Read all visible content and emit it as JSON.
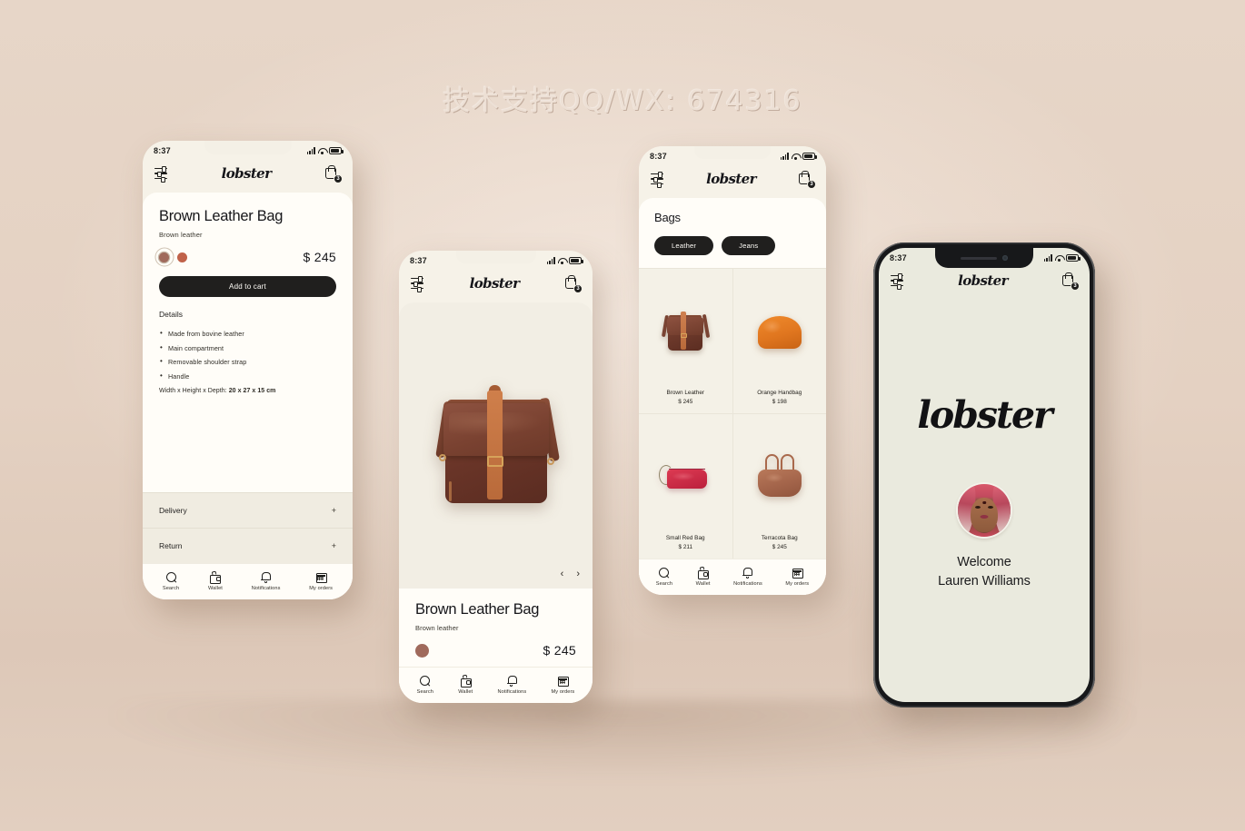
{
  "watermark": "技术支持QQ/WX: 674316",
  "theme": {
    "background": "#e3d0c1",
    "screen_bg": "#f6f2e8",
    "sheet_bg": "#fffdf8",
    "ink": "#1d1d1b",
    "accent_dark": "#201f1e",
    "swatch_selected": "#a06a5c",
    "swatch_second": "#c0624a"
  },
  "brand": {
    "name": "lobster"
  },
  "status_bar": {
    "time": "8:37",
    "signal_icon": "cellular-signal-icon",
    "wifi_icon": "wifi-icon",
    "battery_icon": "battery-icon"
  },
  "app_header": {
    "filter_icon": "filter-sliders-icon",
    "logo": "lobster",
    "cart_icon": "shopping-bag-icon",
    "cart_badge": "3"
  },
  "bottom_nav": {
    "items": [
      {
        "label": "Search",
        "icon": "search-icon"
      },
      {
        "label": "Wallet",
        "icon": "wallet-icon"
      },
      {
        "label": "Notifications",
        "icon": "bell-icon"
      },
      {
        "label": "My orders",
        "icon": "calendar-icon"
      }
    ]
  },
  "screens": {
    "product_detail": {
      "title": "Brown Leather Bag",
      "subtitle": "Brown leather",
      "price": "$ 245",
      "swatches": [
        {
          "name": "swatch-brown",
          "color": "#a06a5c",
          "selected": true
        },
        {
          "name": "swatch-terracotta",
          "color": "#c0624a",
          "selected": false
        }
      ],
      "add_to_cart_label": "Add to cart",
      "details_heading": "Details",
      "features": [
        "Made from bovine leather",
        "Main compartment",
        "Removable shoulder strap",
        "Handle"
      ],
      "dimensions_label": "Width x Height x Depth:",
      "dimensions_value": "20 x 27 x 15 cm",
      "accordion": [
        {
          "label": "Delivery",
          "toggle": "+"
        },
        {
          "label": "Return",
          "toggle": "+"
        }
      ]
    },
    "product_gallery": {
      "image_alt": "brown-leather-messenger-bag",
      "prev_label": "‹",
      "next_label": "›",
      "title": "Brown Leather Bag",
      "subtitle": "Brown leather",
      "price": "$ 245",
      "swatches": [
        {
          "name": "swatch-brown",
          "color": "#a06a5c",
          "selected": true
        }
      ]
    },
    "catalog": {
      "title": "Bags",
      "chips": [
        {
          "label": "Leather",
          "active": true
        },
        {
          "label": "Jeans",
          "active": false
        }
      ],
      "products": [
        {
          "name": "Brown Leather",
          "price": "$ 245",
          "thumb": "brown-messenger-bag-thumb"
        },
        {
          "name": "Orange Handbag",
          "price": "$ 198",
          "thumb": "orange-clutch-thumb"
        },
        {
          "name": "Small Red Bag",
          "price": "$ 211",
          "thumb": "red-pouch-bag-thumb"
        },
        {
          "name": "Terracota Bag",
          "price": "$ 245",
          "thumb": "terracotta-tote-thumb"
        }
      ]
    },
    "welcome": {
      "logo": "lobster",
      "avatar_alt": "user-avatar-photo",
      "greeting": "Welcome",
      "user_name": "Lauren Williams"
    }
  }
}
